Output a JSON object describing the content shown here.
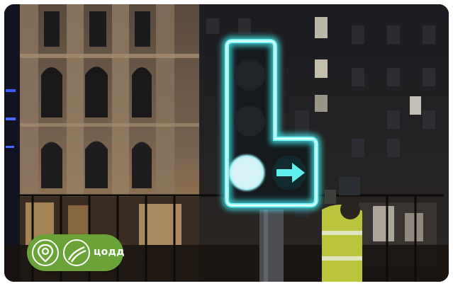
{
  "image": {
    "subject": "night-city-traffic-light",
    "signal_color": "#3fe0e6",
    "arrow_direction": "right"
  },
  "badge": {
    "text": "цодд",
    "color": "#6aa338",
    "icons": [
      "location-pin-icon",
      "road-curve-icon"
    ]
  }
}
